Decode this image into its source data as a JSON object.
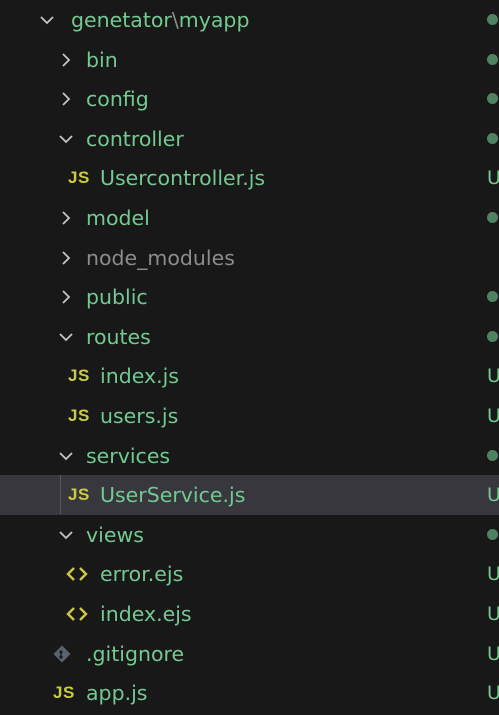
{
  "explorer": {
    "root": {
      "label": "genetator",
      "separator": "\\",
      "label2": "myapp"
    },
    "items": [
      {
        "label": "bin",
        "kind": "folder",
        "state": "collapsed",
        "status": "dot"
      },
      {
        "label": "config",
        "kind": "folder",
        "state": "collapsed",
        "status": "dot"
      },
      {
        "label": "controller",
        "kind": "folder",
        "state": "expanded",
        "status": "dot"
      },
      {
        "label": "Usercontroller.js",
        "kind": "js",
        "status": "U"
      },
      {
        "label": "model",
        "kind": "folder",
        "state": "collapsed",
        "status": "dot"
      },
      {
        "label": "node_modules",
        "kind": "folder",
        "state": "collapsed",
        "status": ""
      },
      {
        "label": "public",
        "kind": "folder",
        "state": "collapsed",
        "status": "dot"
      },
      {
        "label": "routes",
        "kind": "folder",
        "state": "expanded",
        "status": "dot"
      },
      {
        "label": "index.js",
        "kind": "js",
        "status": "U"
      },
      {
        "label": "users.js",
        "kind": "js",
        "status": "U"
      },
      {
        "label": "services",
        "kind": "folder",
        "state": "expanded",
        "status": "dot"
      },
      {
        "label": "UserService.js",
        "kind": "js",
        "status": "U"
      },
      {
        "label": "views",
        "kind": "folder",
        "state": "expanded",
        "status": "dot"
      },
      {
        "label": "error.ejs",
        "kind": "ejs",
        "status": "U"
      },
      {
        "label": "index.ejs",
        "kind": "ejs",
        "status": "U"
      },
      {
        "label": ".gitignore",
        "kind": "git",
        "status": "U"
      },
      {
        "label": "app.js",
        "kind": "js",
        "status": "U"
      }
    ],
    "js_icon_text": "JS",
    "ejs_icon_text": "<>",
    "colors": {
      "background": "#181818",
      "selected_row": "#37373d",
      "untracked_green": "#73c991",
      "ignored_gray": "#8c8c8c",
      "js_yellow": "#cbcb41",
      "chevron": "#c5c5c5"
    }
  }
}
